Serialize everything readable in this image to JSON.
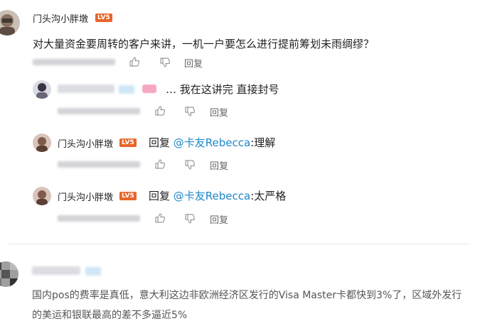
{
  "comments": [
    {
      "username": "门头沟小胖墩",
      "level": "LV5",
      "text": "对大量资金要周转的客户来讲，一机一户要怎么进行提前筹划未雨绸缪？",
      "reply_label": "回复"
    },
    {
      "text": "… 我在这讲完 直接封号",
      "reply_label": "回复"
    },
    {
      "username": "门头沟小胖墩",
      "level": "LV5",
      "reply_prefix": "回复",
      "mention": "@卡友Rebecca",
      "reply_text": ":理解",
      "reply_label": "回复"
    },
    {
      "username": "门头沟小胖墩",
      "level": "LV5",
      "reply_prefix": "回复",
      "mention": "@卡友Rebecca",
      "reply_text": ":太严格",
      "reply_label": "回复"
    },
    {
      "text": "国内pos的费率是真低，意大利这边非欧洲经济区发行的Visa Master卡都快到3%了，区域外发行的美运和银联最高的差不多逼近5%"
    }
  ],
  "colors": {
    "mention": "#1e88c8",
    "level_badge": "#e8652a",
    "divider": "#e6e7ea"
  },
  "icons": [
    "thumbs-up-icon",
    "thumbs-down-icon"
  ]
}
